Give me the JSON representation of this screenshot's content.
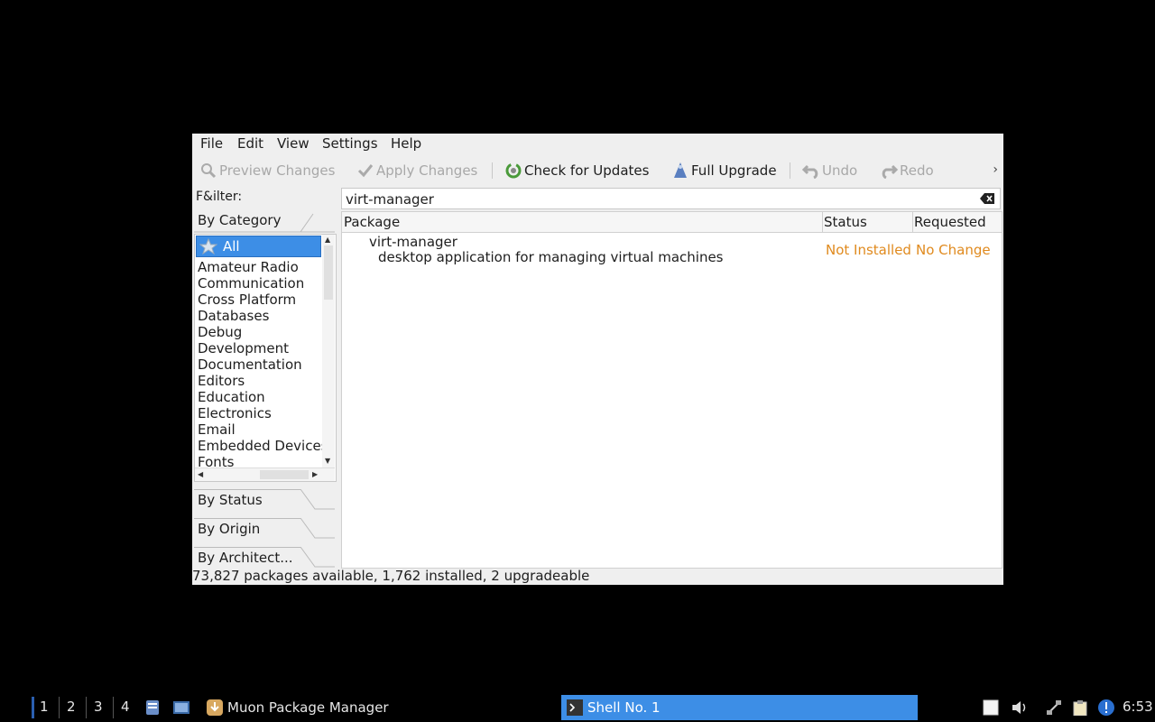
{
  "window": {
    "menubar": {
      "file": "File",
      "edit": "Edit",
      "view": "View",
      "settings": "Settings",
      "help": "Help"
    },
    "toolbar": {
      "preview_changes": "Preview Changes",
      "apply_changes": "Apply Changes",
      "check_for_updates": "Check for Updates",
      "full_upgrade": "Full Upgrade",
      "undo": "Undo",
      "redo": "Redo",
      "more": "›"
    },
    "filter_label": "F&ilter:",
    "sections": {
      "by_category": "By Category",
      "by_status": "By Status",
      "by_origin": "By Origin",
      "by_architecture": "By Architect..."
    },
    "categories": [
      "All",
      "Amateur Radio",
      "Communication",
      "Cross Platform",
      "Databases",
      "Debug",
      "Development",
      "Documentation",
      "Editors",
      "Education",
      "Electronics",
      "Email",
      "Embedded Devices",
      "Fonts"
    ],
    "search": {
      "value": "virt-manager"
    },
    "table": {
      "columns": {
        "package": "Package",
        "status": "Status",
        "requested": "Requested"
      },
      "rows": [
        {
          "name": "virt-manager",
          "description": "desktop application for managing virtual machines",
          "status": "Not Installed",
          "requested": "No Change"
        }
      ]
    },
    "statusbar": "73,827 packages available, 1,762 installed, 2 upgradeable"
  },
  "taskbar": {
    "workspaces": [
      "1",
      "2",
      "3",
      "4"
    ],
    "tasks": {
      "muon": "Muon Package Manager",
      "shell": "Shell No. 1"
    },
    "clock": "6:53"
  },
  "colors": {
    "selection": "#3d8ee6",
    "status_text": "#e08a1e",
    "window_bg": "#efefef",
    "desktop_bg": "#000000"
  }
}
